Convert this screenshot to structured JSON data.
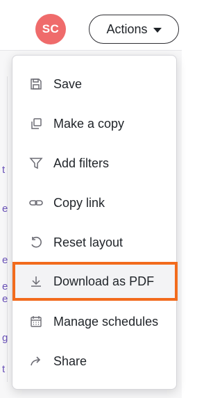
{
  "header": {
    "avatar_initials": "SC",
    "actions_label": "Actions"
  },
  "background": {
    "glyphs": [
      "t",
      "e",
      "e",
      "e",
      "e",
      "g",
      "t"
    ]
  },
  "menu": {
    "items": [
      {
        "label": "Save",
        "icon": "save-icon"
      },
      {
        "label": "Make a copy",
        "icon": "copy-icon"
      },
      {
        "label": "Add filters",
        "icon": "filter-icon"
      },
      {
        "label": "Copy link",
        "icon": "link-icon"
      },
      {
        "label": "Reset layout",
        "icon": "reset-icon"
      },
      {
        "label": "Download as PDF",
        "icon": "download-icon"
      },
      {
        "label": "Manage schedules",
        "icon": "calendar-icon"
      },
      {
        "label": "Share",
        "icon": "share-icon"
      }
    ],
    "highlighted_item": "Download as PDF"
  },
  "colors": {
    "avatar_bg": "#ef6b6b",
    "focus_ring": "#f26b1d",
    "background_link": "#6a52b8"
  }
}
